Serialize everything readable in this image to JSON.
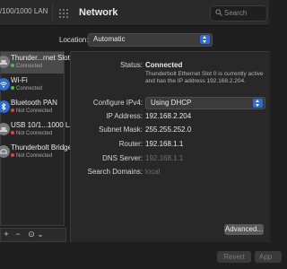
{
  "window": {
    "title": "Network",
    "breadcrumb": "/100/1000 LAN",
    "search_placeholder": "Search",
    "icons": {
      "grid": "grid-icon",
      "search": "search-icon"
    }
  },
  "location": {
    "label": "Location:",
    "value": "Automatic"
  },
  "services": [
    {
      "name": "Thunder...rnet Slot 0",
      "status": "Connected",
      "status_color": "#3fc14a",
      "icon": "ethernet-icon",
      "selected": true
    },
    {
      "name": "Wi-Fi",
      "status": "Connected",
      "status_color": "#3fc14a",
      "icon": "wifi-icon",
      "selected": false
    },
    {
      "name": "Bluetooth PAN",
      "status": "Not Connected",
      "status_color": "#e0443a",
      "icon": "bluetooth-icon",
      "selected": false
    },
    {
      "name": "USB 10/1...1000 LAN",
      "status": "Not Connected",
      "status_color": "#e0443a",
      "icon": "ethernet-icon",
      "selected": false
    },
    {
      "name": "Thunderbolt Bridge",
      "status": "Not Connected",
      "status_color": "#e0443a",
      "icon": "bridge-icon",
      "selected": false
    }
  ],
  "toolbar": {
    "add": "+",
    "remove": "−",
    "gear": "⊙",
    "menu": "⌄"
  },
  "details": {
    "status_label": "Status:",
    "status_value": "Connected",
    "status_desc": "Thunderbolt Ethernet Slot 0 is currently active and has the IP address 192.168.2.204.",
    "configure_label": "Configure IPv4:",
    "configure_value": "Using DHCP",
    "ip_label": "IP Address:",
    "ip_value": "192.168.2.204",
    "subnet_label": "Subnet Mask:",
    "subnet_value": "255.255.252.0",
    "router_label": "Router:",
    "router_value": "192.168.1.1",
    "dns_label": "DNS Server:",
    "dns_value": "192.168.1.1",
    "search_domains_label": "Search Domains:",
    "search_domains_value": "local"
  },
  "buttons": {
    "advanced": "Advanced...",
    "revert": "Revert",
    "apply": "App"
  },
  "colors": {
    "accent": "#2f6bd3",
    "connected": "#3fc14a",
    "not_connected": "#e0443a"
  }
}
